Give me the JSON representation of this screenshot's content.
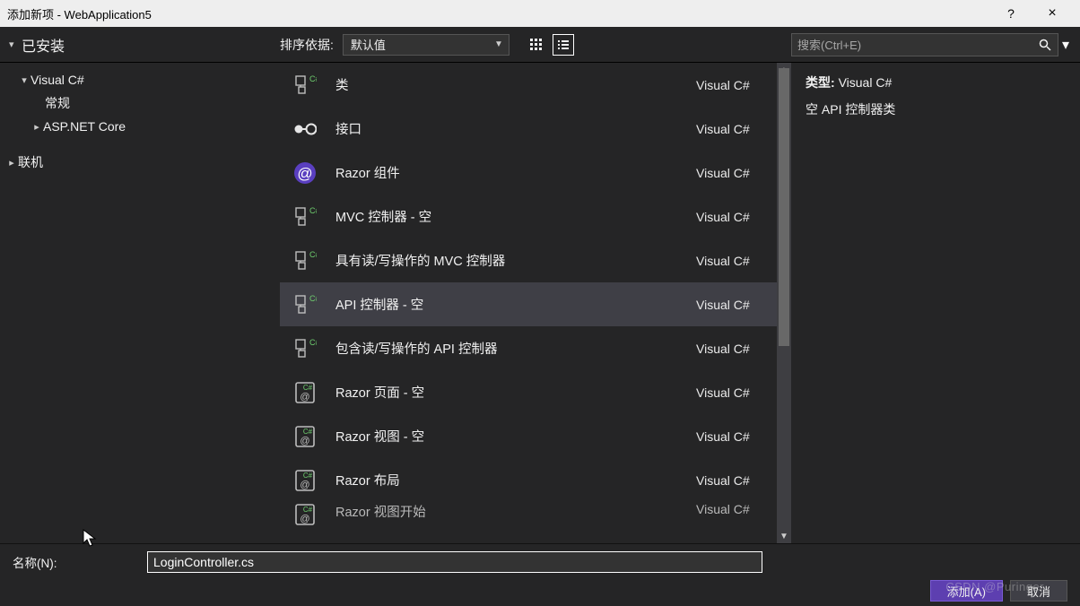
{
  "window": {
    "title": "添加新项 - WebApplication5",
    "help": "?",
    "close": "×"
  },
  "toolbar": {
    "installed_label": "已安装",
    "sort_label": "排序依据:",
    "sort_value": "默认值",
    "search_placeholder": "搜索(Ctrl+E)"
  },
  "tree": {
    "root": "已安装",
    "nodes": [
      {
        "label": "Visual C#",
        "depth": 1,
        "expanded": true
      },
      {
        "label": "常规",
        "depth": 2,
        "expanded": false,
        "leaf": true
      },
      {
        "label": "ASP.NET Core",
        "depth": 2,
        "expanded": false
      },
      {
        "label": "联机",
        "depth": 0,
        "expanded": false
      }
    ]
  },
  "templates": [
    {
      "label": "类",
      "lang": "Visual C#",
      "icon": "csharp-class"
    },
    {
      "label": "接口",
      "lang": "Visual C#",
      "icon": "interface"
    },
    {
      "label": "Razor 组件",
      "lang": "Visual C#",
      "icon": "razor-at"
    },
    {
      "label": "MVC 控制器 - 空",
      "lang": "Visual C#",
      "icon": "csharp-class"
    },
    {
      "label": "具有读/写操作的 MVC 控制器",
      "lang": "Visual C#",
      "icon": "csharp-class"
    },
    {
      "label": "API 控制器 - 空",
      "lang": "Visual C#",
      "icon": "csharp-class",
      "selected": true
    },
    {
      "label": "包含读/写操作的 API 控制器",
      "lang": "Visual C#",
      "icon": "csharp-class"
    },
    {
      "label": "Razor 页面 - 空",
      "lang": "Visual C#",
      "icon": "razor-page"
    },
    {
      "label": "Razor 视图 - 空",
      "lang": "Visual C#",
      "icon": "razor-page"
    },
    {
      "label": "Razor 布局",
      "lang": "Visual C#",
      "icon": "razor-page"
    },
    {
      "label": "Razor 视图开始",
      "lang": "Visual C#",
      "icon": "razor-page",
      "cut": true
    }
  ],
  "info": {
    "type_label": "类型:",
    "type_value": "Visual C#",
    "desc": "空 API 控制器类"
  },
  "footer": {
    "name_label": "名称(N):",
    "name_value": "LoginController.cs",
    "add_label": "添加(A)",
    "cancel_label": "取消"
  },
  "watermark": "CSDN @Puringer"
}
